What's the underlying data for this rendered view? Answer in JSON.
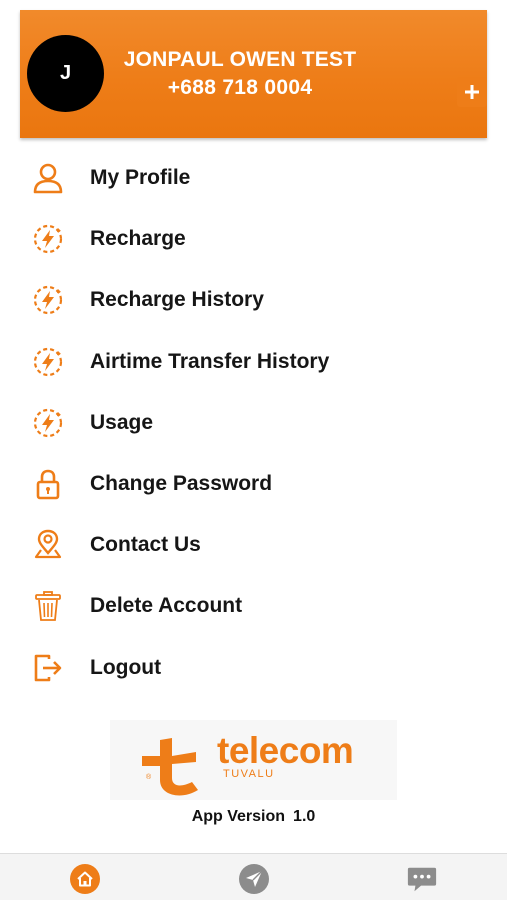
{
  "profile": {
    "avatar_initial": "J",
    "name": "JONPAUL OWEN TEST",
    "phone": "+688 718 0004"
  },
  "menu": {
    "items": [
      {
        "label": "My Profile",
        "icon": "user-icon"
      },
      {
        "label": "Recharge",
        "icon": "lightning-refresh-icon"
      },
      {
        "label": "Recharge History",
        "icon": "lightning-refresh-icon"
      },
      {
        "label": "Airtime Transfer History",
        "icon": "lightning-refresh-icon"
      },
      {
        "label": "Usage",
        "icon": "lightning-refresh-icon"
      },
      {
        "label": "Change Password",
        "icon": "lock-icon"
      },
      {
        "label": "Contact Us",
        "icon": "location-pin-icon"
      },
      {
        "label": "Delete Account",
        "icon": "trash-icon"
      },
      {
        "label": "Logout",
        "icon": "logout-icon"
      }
    ],
    "recharge_add_icon": "plus-icon"
  },
  "logo": {
    "brand": "telecom",
    "sub": "TUVALU",
    "reg": "®"
  },
  "footer": {
    "version_label": "App Version",
    "version_value": "1.0"
  },
  "bottom_nav": [
    "home-icon",
    "send-icon",
    "chat-icon"
  ],
  "colors": {
    "accent": "#EE7D18",
    "nav_inactive": "#8C8C8C"
  }
}
